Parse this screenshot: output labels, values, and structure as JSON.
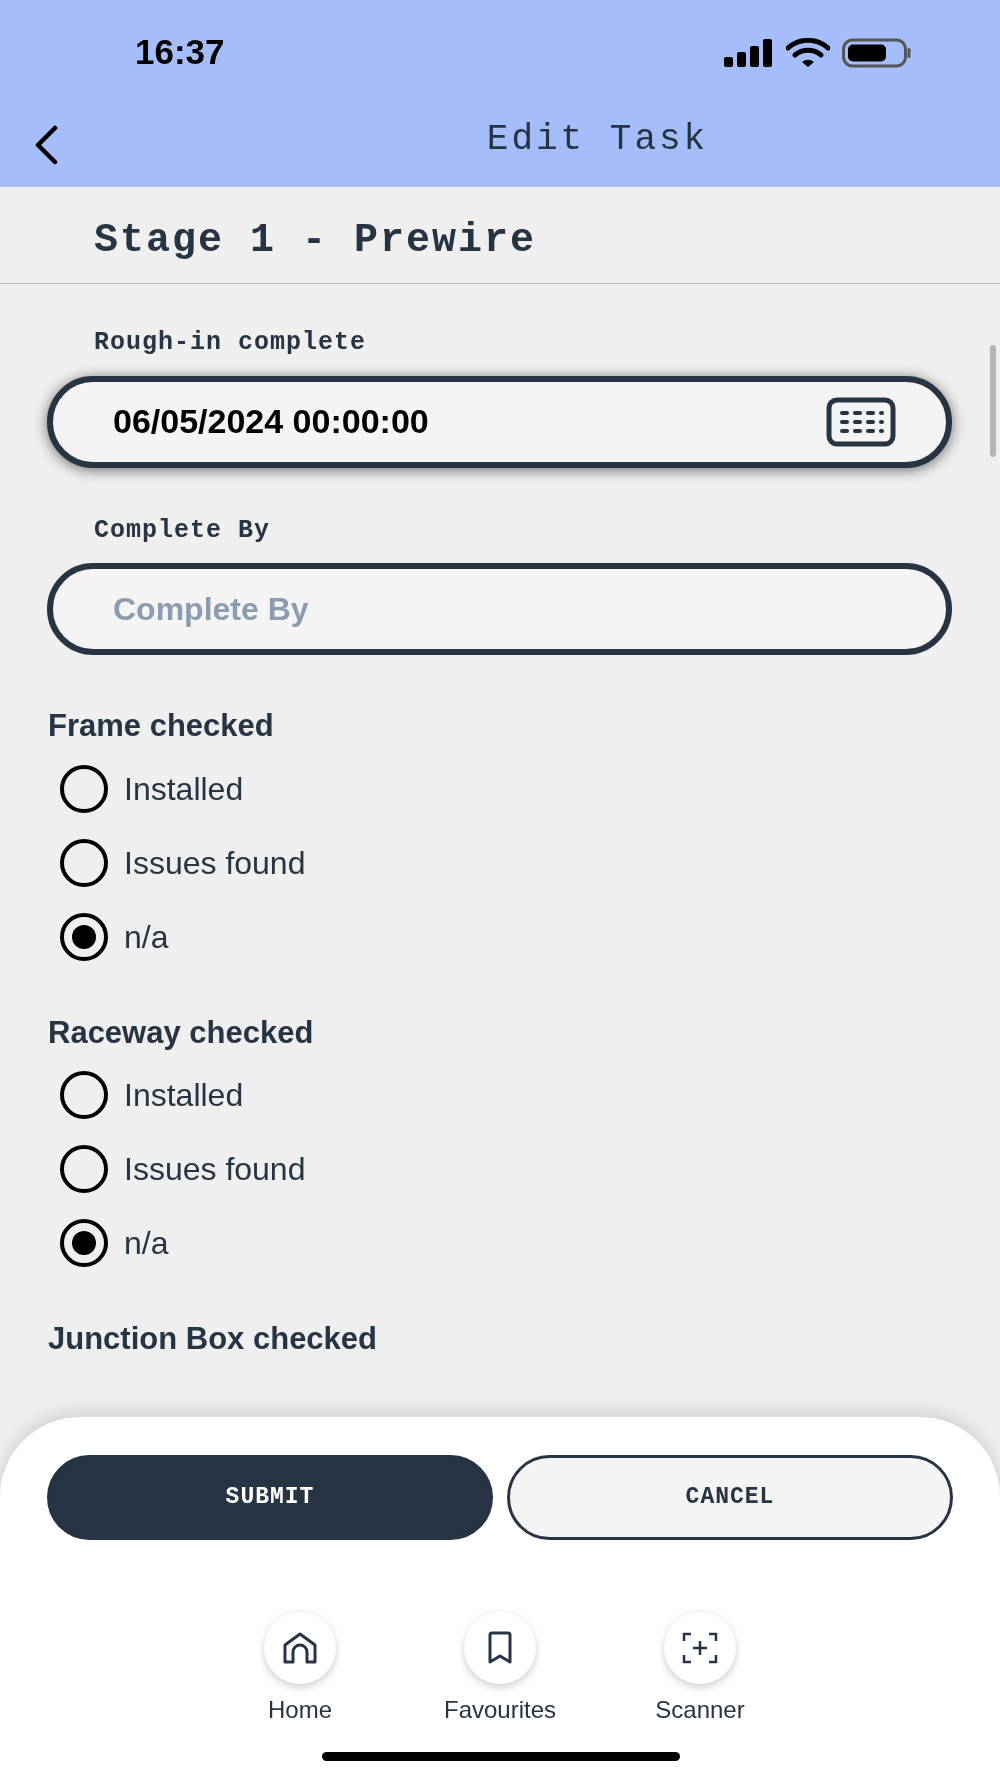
{
  "status_bar": {
    "time": "16:37"
  },
  "header": {
    "title": "Edit Task"
  },
  "section_title": "Stage 1 - Prewire",
  "fields": [
    {
      "label": "Rough-in complete",
      "value": "06/05/2024 00:00:00",
      "kind": "date"
    },
    {
      "label": "Complete By",
      "placeholder": "Complete By",
      "kind": "text"
    }
  ],
  "groups": [
    {
      "title": "Frame checked",
      "options": [
        {
          "label": "Installed",
          "selected": false
        },
        {
          "label": "Issues found",
          "selected": false
        },
        {
          "label": "n/a",
          "selected": true
        }
      ]
    },
    {
      "title": "Raceway checked",
      "options": [
        {
          "label": "Installed",
          "selected": false
        },
        {
          "label": "Issues found",
          "selected": false
        },
        {
          "label": "n/a",
          "selected": true
        }
      ]
    },
    {
      "title": "Junction Box checked"
    }
  ],
  "buttons": [
    {
      "label": "SUBMIT",
      "kind": "primary"
    },
    {
      "label": "CANCEL",
      "kind": "secondary"
    }
  ],
  "nav": [
    {
      "label": "Home",
      "kind": "home"
    },
    {
      "label": "Favourites",
      "kind": "bookmark"
    },
    {
      "label": "Scanner",
      "kind": "scanner"
    }
  ]
}
